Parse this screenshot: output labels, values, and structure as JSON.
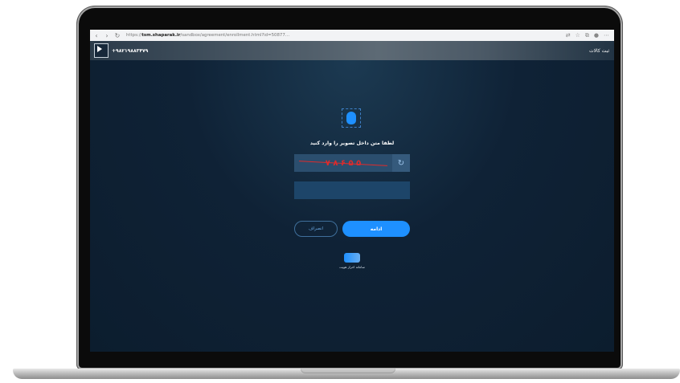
{
  "browser": {
    "back_icon": "arrow-left-icon",
    "forward_icon": "arrow-right-icon",
    "reload_icon": "reload-icon",
    "url_prefix": "https://",
    "url_host": "tsm.shaparak.ir",
    "url_path": "/sandbox/agreement/enrollment.html?id=50877…",
    "right_icons": [
      "translate-icon",
      "star-icon",
      "collections-icon",
      "profile-icon",
      "more-icon"
    ]
  },
  "header": {
    "phone": "+۹۸۲۱۹۸۸۳۴۷۹",
    "register_link": "ثبت کالات"
  },
  "main": {
    "fingerprint_icon": "fingerprint-icon",
    "prompt": "لطفا متن داخل تصویر را وارد کنید",
    "captcha": {
      "text": "۷ ۸ ۶ ۵ ۵",
      "refresh_icon": "refresh-icon"
    },
    "captcha_input": {
      "value": "",
      "placeholder": ""
    },
    "continue_button": "ادامه",
    "cancel_button": "انصراف",
    "footer_text": "سامانه احراز هویت"
  },
  "colors": {
    "accent": "#1e90ff",
    "background": "#0f2236",
    "captcha_text": "#e02b2b"
  }
}
